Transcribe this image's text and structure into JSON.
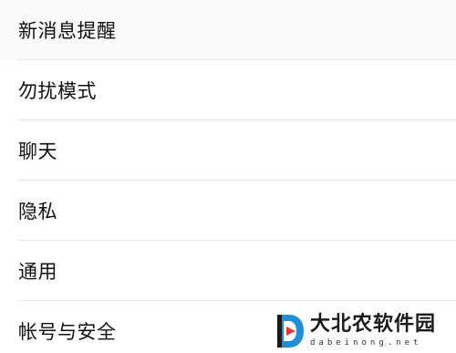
{
  "settings": {
    "items": [
      {
        "label": "新消息提醒"
      },
      {
        "label": "勿扰模式"
      },
      {
        "label": "聊天"
      },
      {
        "label": "隐私"
      },
      {
        "label": "通用"
      },
      {
        "label": "帐号与安全"
      }
    ]
  },
  "watermark": {
    "title": "大北农软件园",
    "subtitle": "dabeinong.net",
    "colors": {
      "blue": "#1E8FD6",
      "red": "#E53935",
      "dark": "#1a1a1a"
    }
  },
  "colors": {
    "divider": "#e6e6e6",
    "text": "#111111",
    "background": "#ffffff"
  }
}
